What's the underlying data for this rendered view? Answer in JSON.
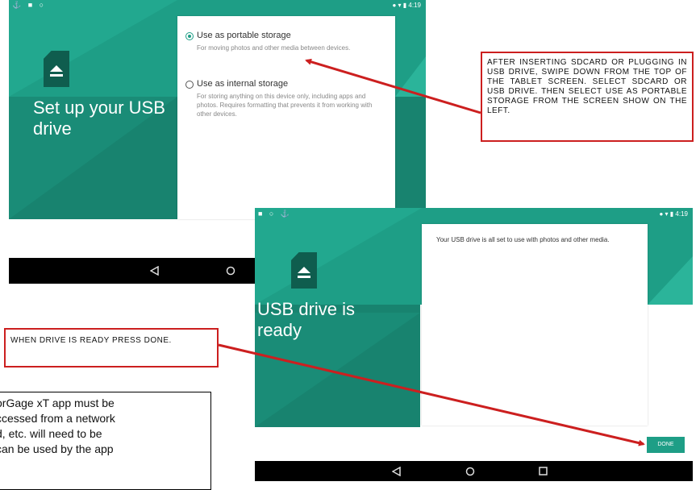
{
  "screen1": {
    "status_right": "4:19",
    "title": "Set up your USB drive",
    "options": [
      {
        "label": "Use as portable storage",
        "description": "For moving photos and other media between devices.",
        "selected": true
      },
      {
        "label": "Use as internal storage",
        "description": "For storing anything on this device only, including apps and photos. Requires formatting that prevents it from working with other devices.",
        "selected": false
      }
    ],
    "nav": {
      "back_icon": "back-triangle-icon",
      "home_icon": "home-circle-icon"
    }
  },
  "screen2": {
    "status_right": "4:19",
    "title": "USB drive is ready",
    "message": "Your USB drive is all set to use with photos and other media.",
    "done_label": "DONE",
    "nav": {
      "back_icon": "back-triangle-icon",
      "home_icon": "home-circle-icon",
      "recents_icon": "recents-square-icon"
    }
  },
  "callouts": {
    "instruction_1": "AFTER INSERTING SDCARD OR PLUGGING IN USB DRIVE, SWIPE DOWN FROM THE TOP OF THE TABLET SCREEN. SELECT SDCARD OR USB DRIVE. THEN SELECT USE AS PORTABLE STORAGE FROM THE SCREEN SHOW ON THE LEFT.",
    "instruction_2": "WHEN DRIVE IS READY PRESS DONE.",
    "description_lines": [
      "orGage xT app must be",
      "ccessed from a network",
      "d, etc. will need to be",
      "can be used by the app"
    ]
  },
  "colors": {
    "teal": "#1e9e86",
    "teal_dark": "#18836f",
    "callout_red": "#cc1f1f"
  }
}
